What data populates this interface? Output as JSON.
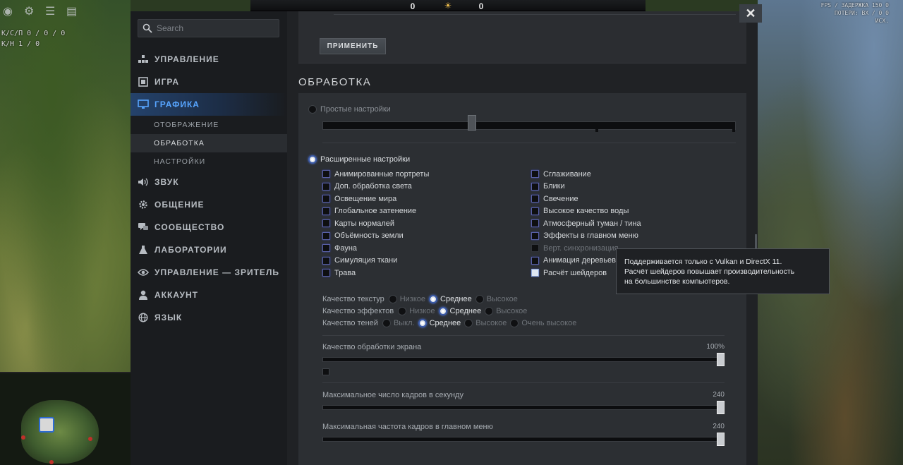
{
  "search": {
    "placeholder": "Search"
  },
  "close": {
    "label": "✕"
  },
  "hud": {
    "kda_line1": "К/С/П  0 / 0 / 0",
    "kda_line2": "К/Н  1 / 0",
    "score_left": "0",
    "score_right": "0",
    "fps_line1": "FPS / ЗАДЕРЖКА  150  0",
    "fps_line2": "ПОТЕРИ: ВХ /  0  0",
    "fps_line3": "ИСХ."
  },
  "sidebar": {
    "items": [
      {
        "label": "УПРАВЛЕНИЕ",
        "icon": "controls-icon"
      },
      {
        "label": "ИГРА",
        "icon": "game-icon"
      },
      {
        "label": "ГРАФИКА",
        "icon": "monitor-icon"
      },
      {
        "label": "ЗВУК",
        "icon": "speaker-icon"
      },
      {
        "label": "ОБЩЕНИЕ",
        "icon": "gear-icon"
      },
      {
        "label": "СООБЩЕСТВО",
        "icon": "chat-icon"
      },
      {
        "label": "ЛАБОРАТОРИИ",
        "icon": "flask-icon"
      },
      {
        "label": "УПРАВЛЕНИЕ — ЗРИТЕЛЬ",
        "icon": "spectator-icon"
      },
      {
        "label": "АККАУНТ",
        "icon": "user-icon"
      },
      {
        "label": "ЯЗЫК",
        "icon": "globe-icon"
      }
    ],
    "graphics_sub": [
      {
        "label": "ОТОБРАЖЕНИЕ"
      },
      {
        "label": "ОБРАБОТКА"
      },
      {
        "label": "НАСТРОЙКИ"
      }
    ],
    "active_item": "ГРАФИКА",
    "active_sub": "ОБРАБОТКА"
  },
  "top_panel": {
    "apply_label": "ПРИМЕНИТЬ"
  },
  "section": {
    "title": "ОБРАБОТКА"
  },
  "modes": {
    "simple": "Простые настройки",
    "advanced": "Расширенные настройки",
    "selected": "advanced"
  },
  "checkboxes_col1": [
    {
      "label": "Анимированные портреты",
      "checked": false
    },
    {
      "label": "Доп. обработка света",
      "checked": false
    },
    {
      "label": "Освещение мира",
      "checked": false
    },
    {
      "label": "Глобальное затенение",
      "checked": false
    },
    {
      "label": "Карты нормалей",
      "checked": false
    },
    {
      "label": "Объёмность земли",
      "checked": false
    },
    {
      "label": "Фауна",
      "checked": false
    },
    {
      "label": "Симуляция ткани",
      "checked": false
    },
    {
      "label": "Трава",
      "checked": false
    }
  ],
  "checkboxes_col2": [
    {
      "label": "Сглаживание",
      "checked": false
    },
    {
      "label": "Блики",
      "checked": false
    },
    {
      "label": "Свечение",
      "checked": false
    },
    {
      "label": "Высокое качество воды",
      "checked": false
    },
    {
      "label": "Атмосферный туман / тина",
      "checked": false
    },
    {
      "label": "Эффекты в главном меню",
      "checked": false
    },
    {
      "label": "Верт. синхронизация",
      "checked": false,
      "disabled": true
    },
    {
      "label": "Анимация деревьев",
      "checked": false
    },
    {
      "label": "Расчёт шейдеров",
      "checked": true
    }
  ],
  "quality": {
    "textures": {
      "label": "Качество текстур",
      "options": [
        "Низкое",
        "Среднее",
        "Высокое"
      ],
      "selected": "Среднее"
    },
    "effects": {
      "label": "Качество эффектов",
      "options": [
        "Низкое",
        "Среднее",
        "Высокое"
      ],
      "selected": "Среднее"
    },
    "shadows": {
      "label": "Качество теней",
      "options": [
        "Выкл.",
        "Среднее",
        "Высокое",
        "Очень высокое"
      ],
      "selected": "Среднее"
    }
  },
  "sliders": {
    "screen": {
      "label": "Качество обработки экрана",
      "value": "100%",
      "fraction": 1.0
    },
    "fps_max": {
      "label": "Максимальное число кадров в секунду",
      "value": "240",
      "fraction": 1.0
    },
    "fps_menu": {
      "label": "Максимальная частота кадров в главном меню",
      "value": "240",
      "fraction": 1.0
    }
  },
  "tooltip": {
    "line1": "Поддерживается только с Vulkan и DirectX 11.",
    "line2": "Расчёт шейдеров повышает производительность",
    "line3": "на большинстве компьютеров."
  },
  "colors": {
    "accent": "#57a5ff",
    "panel": "#2c2f33",
    "sidebar": "#1a1c1f"
  }
}
